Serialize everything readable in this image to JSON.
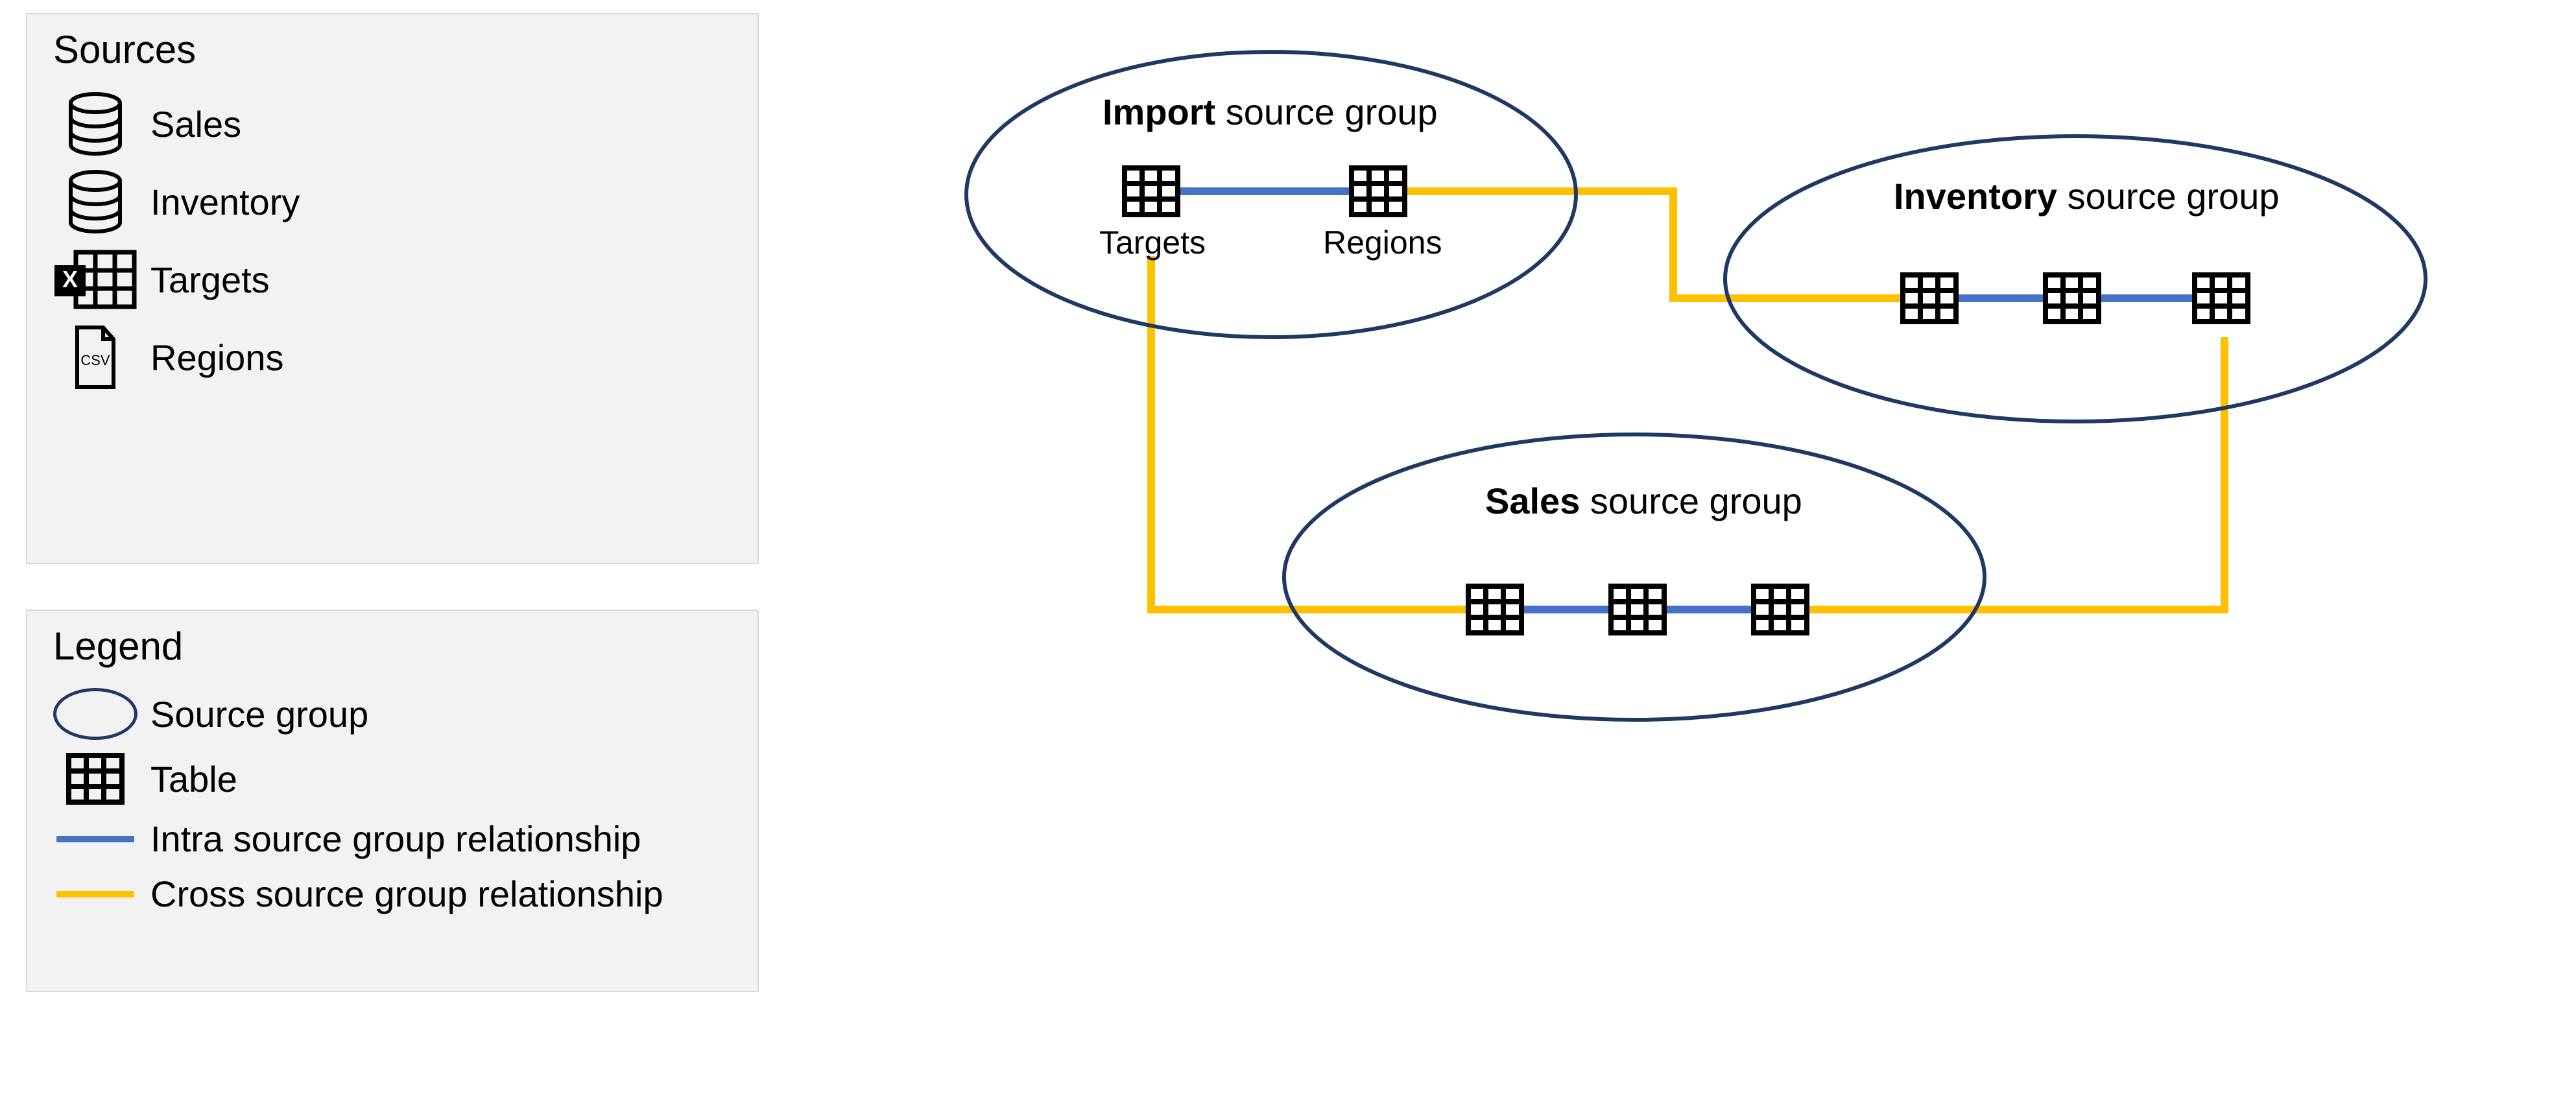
{
  "sources_panel": {
    "title": "Sources",
    "items": [
      {
        "icon": "database",
        "label": "Sales"
      },
      {
        "icon": "database",
        "label": "Inventory"
      },
      {
        "icon": "excel",
        "label": "Targets"
      },
      {
        "icon": "csv",
        "label": "Regions"
      }
    ]
  },
  "legend_panel": {
    "title": "Legend",
    "items": [
      {
        "kind": "ellipse",
        "label": "Source group"
      },
      {
        "kind": "table",
        "label": "Table"
      },
      {
        "kind": "line",
        "color": "#4472C4",
        "label": "Intra source group relationship"
      },
      {
        "kind": "line",
        "color": "#FFC000",
        "label": "Cross source group relationship"
      }
    ]
  },
  "colors": {
    "ellipse_stroke": "#1F3864",
    "intra": "#4472C4",
    "cross": "#FFC000"
  },
  "diagram": {
    "groups": [
      {
        "id": "import",
        "title_bold": "Import",
        "title_rest": " source group",
        "tables": [
          {
            "id": "targets",
            "label": "Targets"
          },
          {
            "id": "regions",
            "label": "Regions"
          }
        ]
      },
      {
        "id": "inventory",
        "title_bold": "Inventory",
        "title_rest": " source group",
        "tables": [
          {
            "id": "inv1",
            "label": ""
          },
          {
            "id": "inv2",
            "label": ""
          },
          {
            "id": "inv3",
            "label": ""
          }
        ]
      },
      {
        "id": "sales",
        "title_bold": "Sales",
        "title_rest": " source group",
        "tables": [
          {
            "id": "s1",
            "label": ""
          },
          {
            "id": "s2",
            "label": ""
          },
          {
            "id": "s3",
            "label": ""
          }
        ]
      }
    ],
    "intra_edges": [
      [
        "targets",
        "regions"
      ],
      [
        "inv1",
        "inv2"
      ],
      [
        "inv2",
        "inv3"
      ],
      [
        "s1",
        "s2"
      ],
      [
        "s2",
        "s3"
      ]
    ],
    "cross_edges": [
      {
        "path": [
          "regions",
          "inv1"
        ]
      },
      {
        "path": [
          "targets",
          "s1"
        ]
      },
      {
        "path": [
          "inv3",
          "s3"
        ]
      }
    ]
  }
}
